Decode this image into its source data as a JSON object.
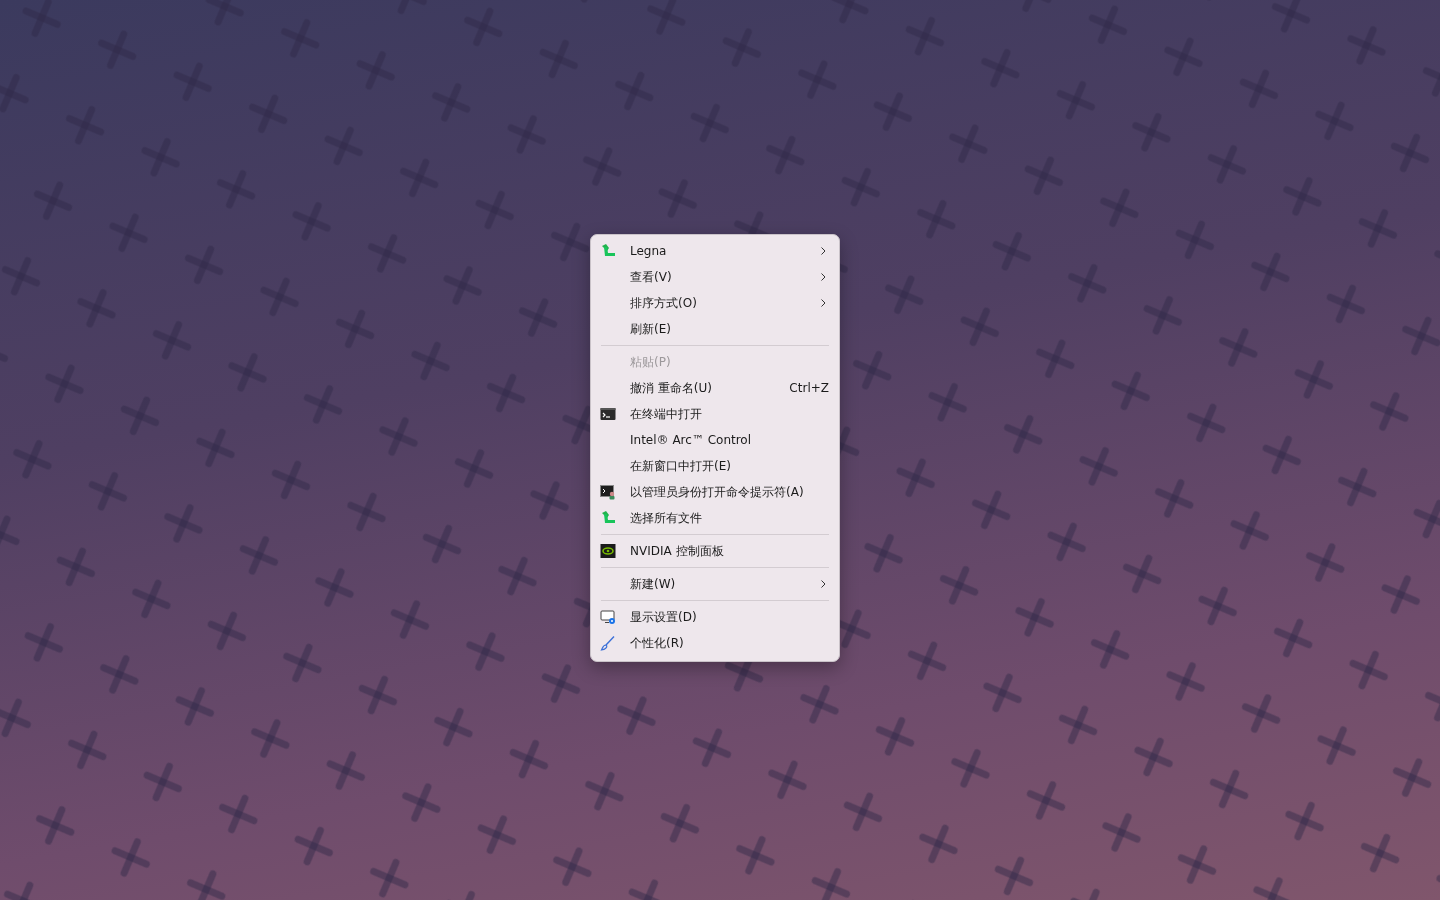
{
  "context_menu": {
    "items": [
      {
        "kind": "item",
        "label": "Legna",
        "submenu": true,
        "disabled": false
      },
      {
        "kind": "item",
        "label": "查看(V)",
        "submenu": true,
        "disabled": false
      },
      {
        "kind": "item",
        "label": "排序方式(O)",
        "submenu": true,
        "disabled": false
      },
      {
        "kind": "item",
        "label": "刷新(E)",
        "submenu": false,
        "disabled": false
      },
      {
        "kind": "separator"
      },
      {
        "kind": "item",
        "label": "粘贴(P)",
        "submenu": false,
        "disabled": true
      },
      {
        "kind": "item",
        "label": "撤消 重命名(U)",
        "shortcut": "Ctrl+Z",
        "submenu": false,
        "disabled": false
      },
      {
        "kind": "item",
        "label": "在终端中打开",
        "submenu": false,
        "disabled": false
      },
      {
        "kind": "item",
        "label": "Intel® Arc™ Control",
        "submenu": false,
        "disabled": false
      },
      {
        "kind": "item",
        "label": "在新窗口中打开(E)",
        "submenu": false,
        "disabled": false
      },
      {
        "kind": "item",
        "label": "以管理员身份打开命令提示符(A)",
        "submenu": false,
        "disabled": false
      },
      {
        "kind": "item",
        "label": "选择所有文件",
        "submenu": false,
        "disabled": false
      },
      {
        "kind": "separator"
      },
      {
        "kind": "item",
        "label": "NVIDIA 控制面板",
        "submenu": false,
        "disabled": false
      },
      {
        "kind": "separator"
      },
      {
        "kind": "item",
        "label": "新建(W)",
        "submenu": true,
        "disabled": false
      },
      {
        "kind": "separator"
      },
      {
        "kind": "item",
        "label": "显示设置(D)",
        "submenu": false,
        "disabled": false
      },
      {
        "kind": "item",
        "label": "个性化(R)",
        "submenu": false,
        "disabled": false
      }
    ]
  }
}
